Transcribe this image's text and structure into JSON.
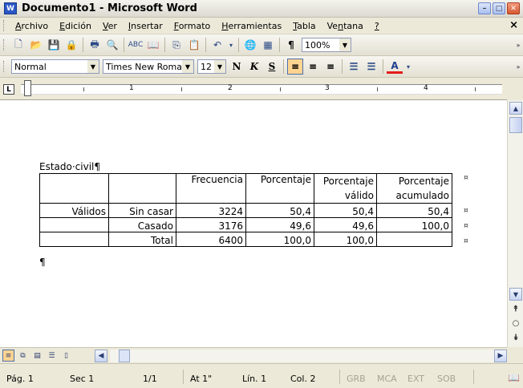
{
  "window": {
    "title": "Documento1 - Microsoft Word",
    "app_icon": "W",
    "minimize": "–",
    "restore": "□",
    "close": "✕"
  },
  "menu": {
    "items": [
      {
        "label": "Archivo",
        "ul": "A",
        "rest": "rchivo"
      },
      {
        "label": "Edición",
        "ul": "E",
        "rest": "dición"
      },
      {
        "label": "Ver",
        "ul": "V",
        "rest": "er"
      },
      {
        "label": "Insertar",
        "ul": "I",
        "rest": "nsertar"
      },
      {
        "label": "Formato",
        "ul": "F",
        "rest": "ormato"
      },
      {
        "label": "Herramientas",
        "ul": "H",
        "rest": "erramientas"
      },
      {
        "label": "Tabla",
        "ul": "T",
        "rest": "abla"
      },
      {
        "label": "Ventana",
        "pre": "Ve",
        "ul": "n",
        "rest": "tana"
      },
      {
        "label": "?",
        "ul": "?",
        "rest": ""
      }
    ],
    "close_doc": "×"
  },
  "standard_toolbar": {
    "zoom": "100%",
    "pilcrow": "¶",
    "icons": [
      "new-doc-icon",
      "open-icon",
      "save-icon",
      "permission-icon",
      "print-icon",
      "print-preview-icon",
      "spelling-icon",
      "research-icon",
      "copy-icon",
      "paste-icon",
      "undo-icon",
      "hyperlink-icon",
      "table-icon",
      "show-formatting-icon"
    ]
  },
  "format_toolbar": {
    "style": "Normal",
    "font": "Times New Roman",
    "size": "12",
    "bold": "N",
    "italic": "K",
    "underline": "S",
    "font_color": "A"
  },
  "ruler": {
    "tab_selector": "L",
    "numbers": [
      "1",
      "2",
      "3",
      "4"
    ]
  },
  "document": {
    "heading": "Estado·civil¶",
    "pilcrow": "¶",
    "table": {
      "header": [
        "",
        "",
        "Frecuencia",
        "Porcentaje",
        "Porcentaje válido",
        "Porcentaje acumulado"
      ],
      "header_line1": [
        "",
        "",
        "Frecuencia",
        "Porcentaje",
        "Porcentaje",
        "Porcentaje"
      ],
      "header_line2": [
        "",
        "",
        "",
        "",
        "válido",
        "acumulado"
      ],
      "rows": [
        [
          "Válidos",
          "Sin casar",
          "3224",
          "50,4",
          "50,4",
          "50,4"
        ],
        [
          "",
          "Casado",
          "3176",
          "49,6",
          "49,6",
          "100,0"
        ],
        [
          "",
          "Total",
          "6400",
          "100,0",
          "100,0",
          ""
        ]
      ],
      "row_end_mark": "¤"
    }
  },
  "status": {
    "page": "Pág.  1",
    "section": "Sec  1",
    "pages": "1/1",
    "at": "At  1\"",
    "line": "Lín. 1",
    "col": "Col. 2",
    "grb": "GRB",
    "mca": "MCA",
    "ext": "EXT",
    "sob": "SOB"
  }
}
